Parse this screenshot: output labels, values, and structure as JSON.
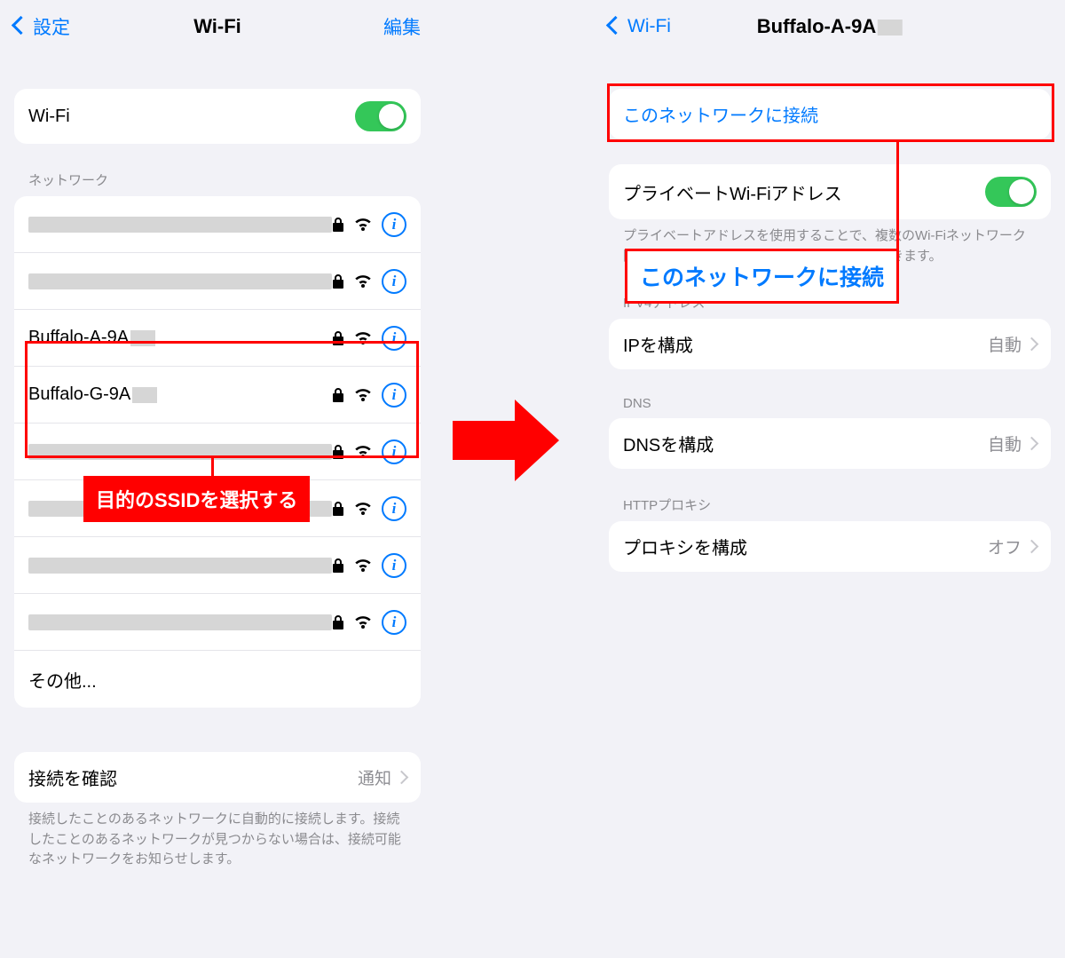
{
  "left": {
    "nav": {
      "back": "設定",
      "title": "Wi-Fi",
      "edit": "編集"
    },
    "wifi_toggle_label": "Wi-Fi",
    "section_networks": "ネットワーク",
    "networks": [
      {
        "name": "",
        "redacted": true
      },
      {
        "name": "",
        "redacted": true
      },
      {
        "name": "Buffalo-A-9A",
        "redacted": false,
        "suffix_hidden": true
      },
      {
        "name": "Buffalo-G-9A",
        "redacted": false,
        "suffix_hidden": true
      },
      {
        "name": "",
        "redacted": true
      },
      {
        "name": "",
        "redacted": true
      },
      {
        "name": "",
        "redacted": true
      },
      {
        "name": "",
        "redacted": true
      }
    ],
    "other": "その他...",
    "ask_to_join": {
      "label": "接続を確認",
      "value": "通知"
    },
    "ask_footer": "接続したことのあるネットワークに自動的に接続します。接続したことのあるネットワークが見つからない場合は、接続可能なネットワークをお知らせします。",
    "annotation": "目的のSSIDを選択する"
  },
  "right": {
    "nav": {
      "back": "Wi-Fi",
      "title": "Buffalo-A-9A"
    },
    "join_label": "このネットワークに接続",
    "private_addr_label": "プライベートWi-Fiアドレス",
    "private_footer": "プライベートアドレスを使用することで、複数のWi-Fiネットワーク間のiPhoneのトラッキングを減らすことができます。",
    "ipv4_header": "IPV4アドレス",
    "ip_config": {
      "label": "IPを構成",
      "value": "自動"
    },
    "dns_header": "DNS",
    "dns_config": {
      "label": "DNSを構成",
      "value": "自動"
    },
    "proxy_header": "HTTPプロキシ",
    "proxy_config": {
      "label": "プロキシを構成",
      "value": "オフ"
    },
    "annotation": "このネットワークに接続"
  }
}
